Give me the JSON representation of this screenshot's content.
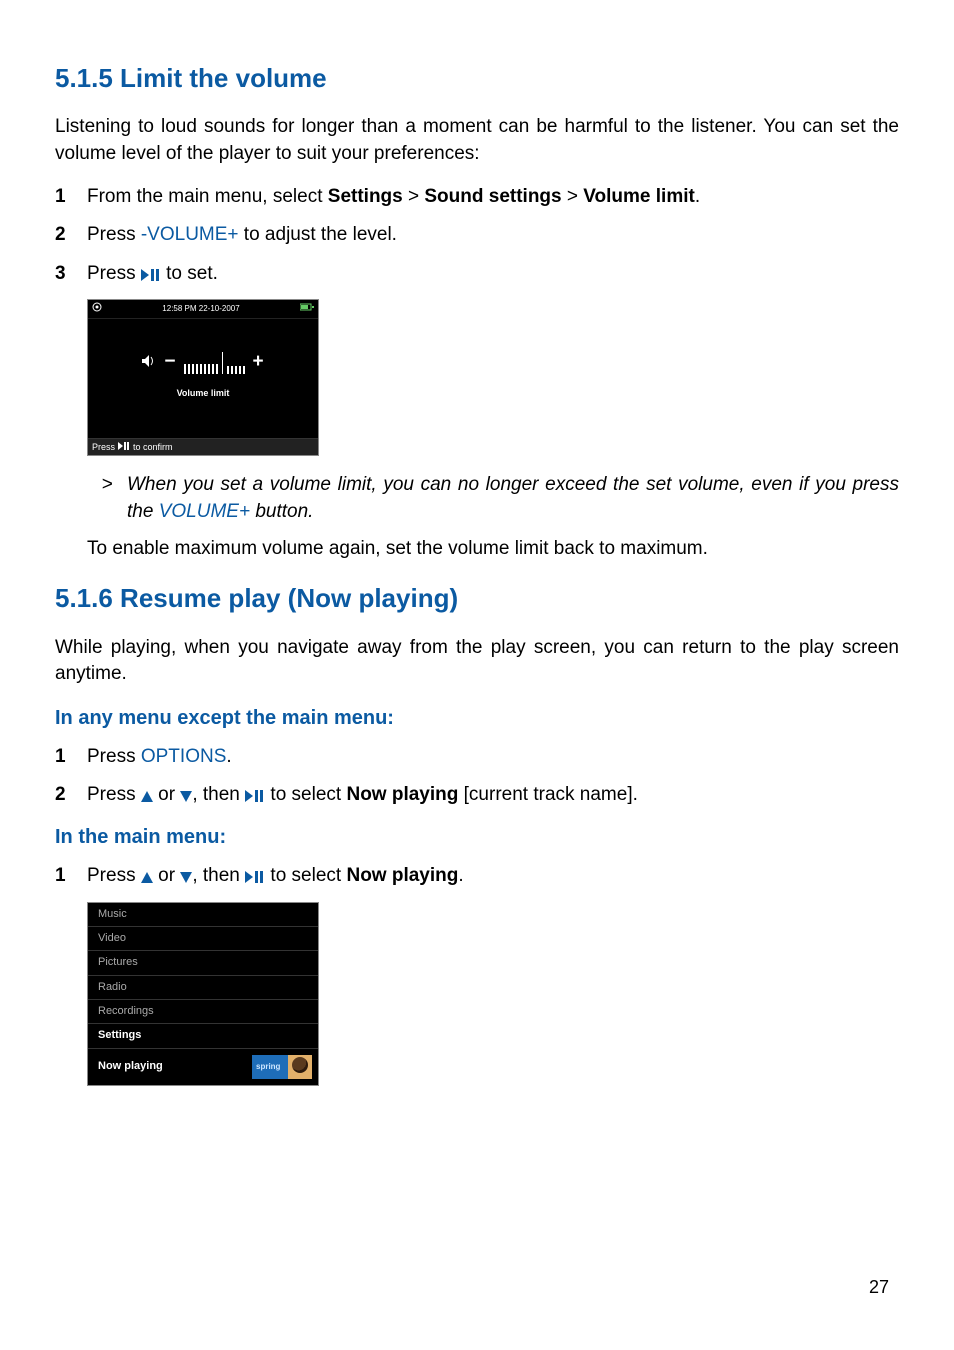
{
  "section515": {
    "heading": "5.1.5 Limit the volume",
    "intro": "Listening to loud sounds for longer than a moment can be harmful to the listener. You can set the volume level of the player to suit your preferences:",
    "step1_prefix": "From the main menu, select ",
    "step1_b1": "Settings",
    "step1_gt1": " > ",
    "step1_b2": "Sound settings",
    "step1_gt2": " > ",
    "step1_b3": "Volume limit",
    "step1_suffix": ".",
    "step2_prefix": "Press ",
    "step2_key": "-VOLUME+",
    "step2_suffix": " to adjust the level.",
    "step3_prefix": "Press ",
    "step3_suffix": " to set.",
    "note_gt": ">",
    "note_text_a": "When you set a volume limit, you can no longer exceed the set volume, even if you press the ",
    "note_key": "VOLUME+",
    "note_text_b": " button.",
    "after_note": "To enable maximum volume again, set the volume limit back to maximum."
  },
  "device1": {
    "time": "12:58 PM 22-10-2007",
    "label": "Volume limit",
    "foot_a": "Press",
    "foot_b": "to confirm"
  },
  "section516": {
    "heading": "5.1.6 Resume play (Now playing)",
    "intro": "While playing, when you navigate away from the play screen, you can return to the play screen anytime.",
    "sub1": "In any menu except the main menu:",
    "s1_step1_a": "Press ",
    "s1_step1_key": "OPTIONS",
    "s1_step1_b": ".",
    "s1_step2_a": "Press ",
    "s1_step2_mid1": " or ",
    "s1_step2_mid2": ", then ",
    "s1_step2_mid3": " to select ",
    "s1_step2_bold": "Now playing",
    "s1_step2_tail": " [current track name].",
    "sub2": "In the main menu:",
    "s2_step1_a": "Press ",
    "s2_step1_mid1": " or ",
    "s2_step1_mid2": ", then ",
    "s2_step1_mid3": " to select ",
    "s2_step1_bold": "Now playing",
    "s2_step1_tail": "."
  },
  "device2": {
    "items": [
      "Music",
      "Video",
      "Pictures",
      "Radio",
      "Recordings",
      "Settings"
    ],
    "now_playing": "Now playing",
    "art_label": "spring"
  },
  "nums": {
    "n1": "1",
    "n2": "2",
    "n3": "3"
  },
  "page_number": "27"
}
